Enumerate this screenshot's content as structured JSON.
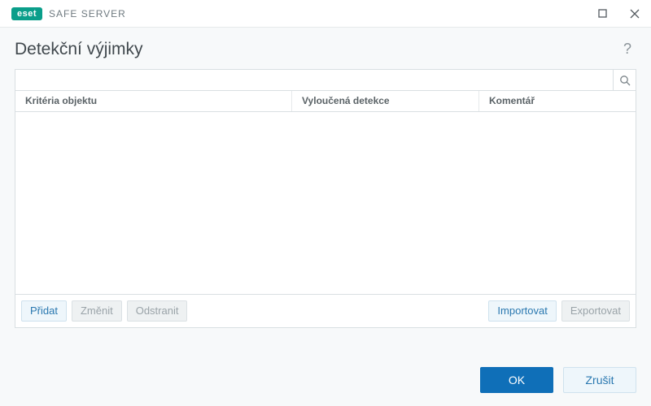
{
  "brand": {
    "badge": "eset",
    "product": "SAFE SERVER"
  },
  "page": {
    "title": "Detekční výjimky"
  },
  "search": {
    "value": "",
    "placeholder": ""
  },
  "table": {
    "columns": [
      "Kritéria objektu",
      "Vyloučená detekce",
      "Komentář"
    ],
    "rows": []
  },
  "actions": {
    "add": "Přidat",
    "edit": "Změnit",
    "delete": "Odstranit",
    "import": "Importovat",
    "export": "Exportovat"
  },
  "footer": {
    "ok": "OK",
    "cancel": "Zrušit"
  }
}
